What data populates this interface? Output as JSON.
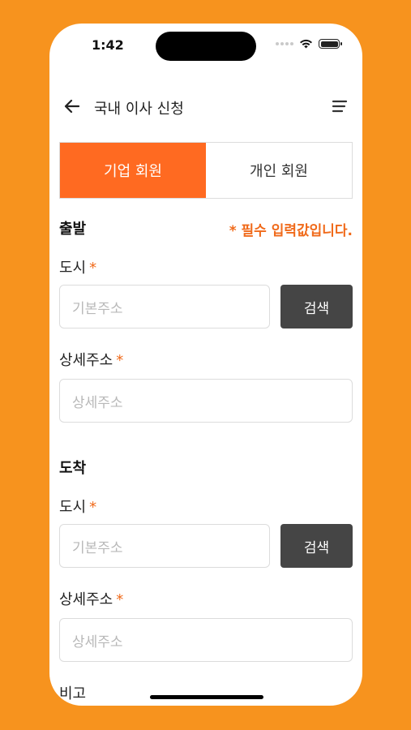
{
  "status_bar": {
    "time": "1:42"
  },
  "header": {
    "title": "국내 이사 신청"
  },
  "tabs": [
    {
      "label": "기업 회원",
      "active": true
    },
    {
      "label": "개인 회원",
      "active": false
    }
  ],
  "departure": {
    "title": "출발",
    "required_note": "* 필수 입력값입니다.",
    "city_label": "도시",
    "city_placeholder": "기본주소",
    "search_label": "검색",
    "detail_label": "상세주소",
    "detail_placeholder": "상세주소"
  },
  "arrival": {
    "title": "도착",
    "city_label": "도시",
    "city_placeholder": "기본주소",
    "search_label": "검색",
    "detail_label": "상세주소",
    "detail_placeholder": "상세주소"
  },
  "remarks": {
    "label": "비고"
  },
  "colors": {
    "background": "#F7931E",
    "accent": "#FF6A21",
    "required": "#F06A1A",
    "button_dark": "#454545"
  },
  "icons": [
    "back-arrow-icon",
    "menu-icon",
    "wifi-icon",
    "battery-icon",
    "asterisk-icon"
  ]
}
